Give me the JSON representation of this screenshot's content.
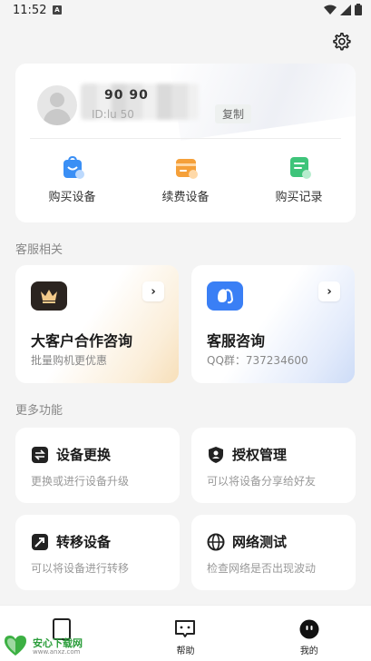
{
  "status_bar": {
    "time": "11:52",
    "notification_badge": "A"
  },
  "profile": {
    "name": "90 90",
    "device_id": "ID:lu 50",
    "copy_label": "复制"
  },
  "quick_actions": [
    {
      "label": "购买设备",
      "icon": "shopping-bag-icon",
      "color": "#3a8ff5"
    },
    {
      "label": "续费设备",
      "icon": "folder-card-icon",
      "color": "#f5a03a"
    },
    {
      "label": "购买记录",
      "icon": "record-list-icon",
      "color": "#3ec47a"
    }
  ],
  "customer_service": {
    "section_title": "客服相关",
    "cards": [
      {
        "title": "大客户合作咨询",
        "subtitle": "批量购机更优惠",
        "icon": "crown-icon",
        "icon_bg": "#2b2420"
      },
      {
        "title": "客服咨询",
        "subtitle": "QQ群：737234600",
        "icon": "qq-icon",
        "icon_bg": "#3a7ff5"
      }
    ]
  },
  "more_functions": {
    "section_title": "更多功能",
    "cards": [
      {
        "title": "设备更换",
        "subtitle": "更换或进行设备升级",
        "icon": "swap-icon"
      },
      {
        "title": "授权管理",
        "subtitle": "可以将设备分享给好友",
        "icon": "shield-user-icon"
      },
      {
        "title": "转移设备",
        "subtitle": "可以将设备进行转移",
        "icon": "transfer-arrow-icon"
      },
      {
        "title": "网络测试",
        "subtitle": "检查网络是否出现波动",
        "icon": "globe-icon"
      }
    ]
  },
  "tabbar": {
    "tabs": [
      {
        "label": "",
        "icon": "device-icon"
      },
      {
        "label": "帮助",
        "icon": "help-chat-icon"
      },
      {
        "label": "我的",
        "icon": "profile-face-icon"
      }
    ]
  },
  "watermark": {
    "name": "安心下载网",
    "url": "www.anxz.com"
  }
}
